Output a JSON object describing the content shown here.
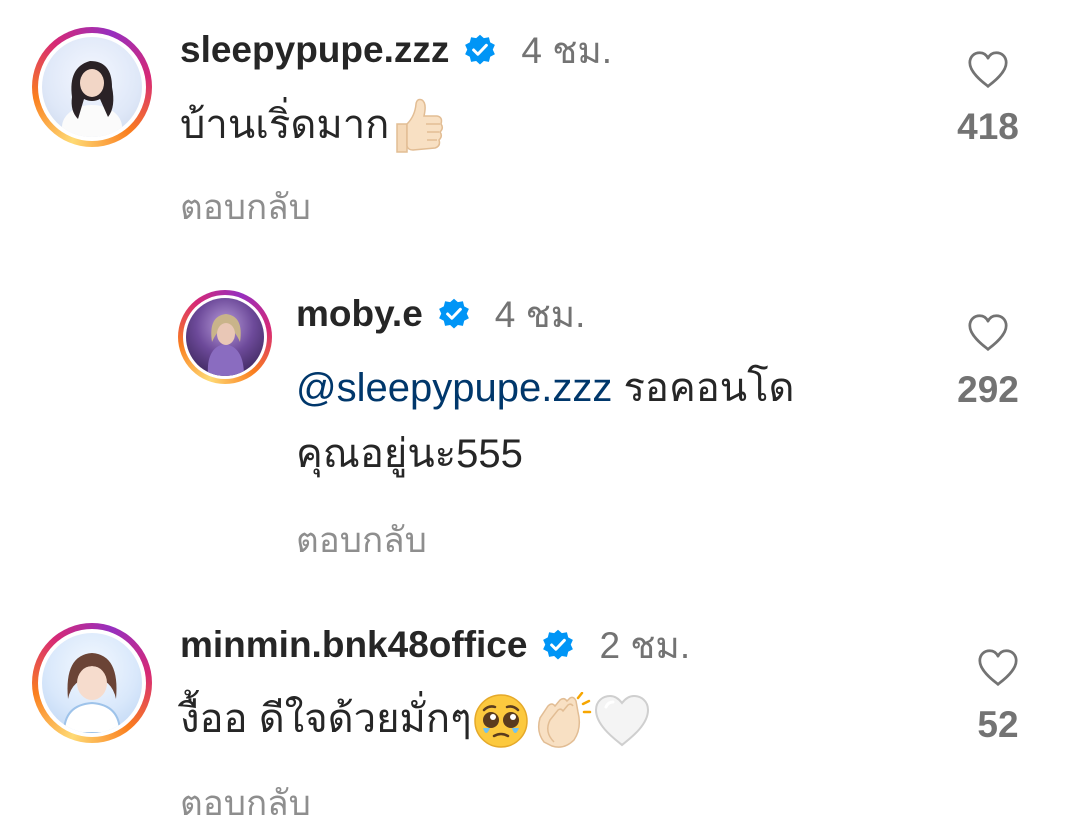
{
  "comments": [
    {
      "username": "sleepypupe.zzz",
      "time": "4 ชม.",
      "text": "บ้านเริ่ดมาก",
      "emoji": [
        "thumbs-up"
      ],
      "reply_label": "ตอบกลับ",
      "likes": "418"
    },
    {
      "username": "moby.e",
      "time": "4 ชม.",
      "mention": "@sleepypupe.zzz",
      "text_line1": " รอคอนโด",
      "text_line2": "คุณอยู่นะ555",
      "reply_label": "ตอบกลับ",
      "likes": "292"
    },
    {
      "username": "minmin.bnk48office",
      "time": "2 ชม.",
      "text": "งื้ออ ดีใจด้วยมั่กๆ",
      "emoji": [
        "pleading-face",
        "clapping-hands",
        "white-heart"
      ],
      "reply_label": "ตอบกลับ",
      "likes": "52"
    }
  ],
  "colors": {
    "verified": "#0095f6",
    "mention": "#00376b",
    "secondary_text": "#737373"
  }
}
